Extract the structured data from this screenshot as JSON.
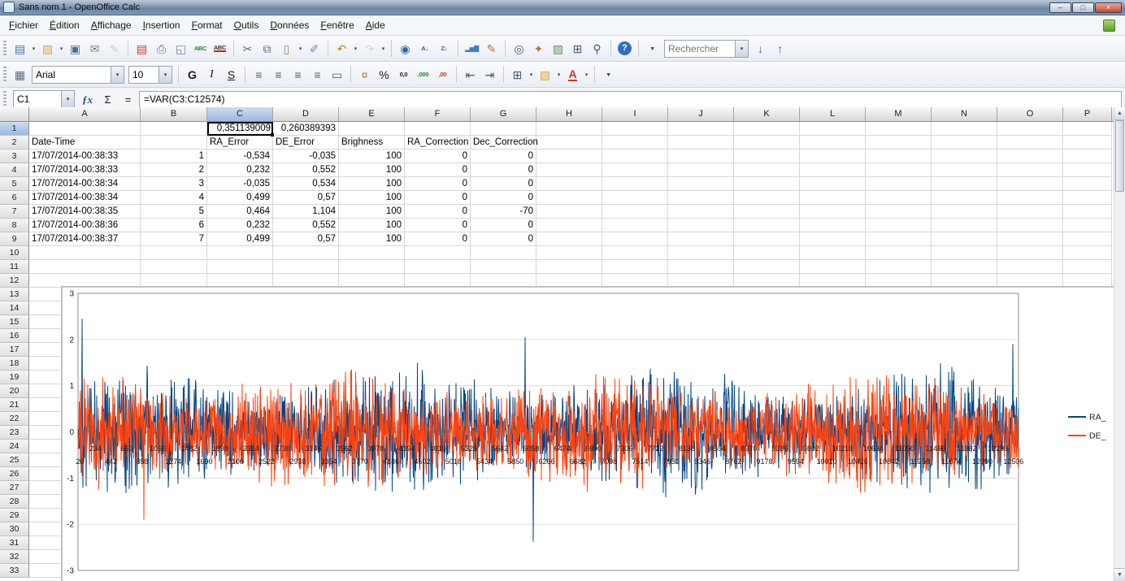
{
  "window": {
    "title": "Sans nom 1 - OpenOffice Calc",
    "controls": [
      {
        "name": "minimize",
        "glyph": "–"
      },
      {
        "name": "maximize",
        "glyph": "□"
      },
      {
        "name": "close",
        "glyph": "×"
      }
    ]
  },
  "menu_items": [
    "Fichier",
    "Édition",
    "Affichage",
    "Insertion",
    "Format",
    "Outils",
    "Données",
    "Fenêtre",
    "Aide"
  ],
  "ui": {
    "dropdown_glyph": "▾",
    "up_glyph": "▲",
    "down_glyph": "▼"
  },
  "search": {
    "placeholder": "Rechercher"
  },
  "standard_toolbar": {
    "items": [
      {
        "name": "new-document",
        "glyph": "▤",
        "color": "#4f6d99",
        "dropdown": true
      },
      {
        "name": "open-document",
        "glyph": "▨",
        "color": "#d9a33c",
        "dropdown": true
      },
      {
        "name": "save-document",
        "glyph": "▣",
        "color": "#4f6d99"
      },
      {
        "name": "document-as-email",
        "glyph": "✉",
        "color": "#6e7f94"
      },
      {
        "name": "edit-file",
        "glyph": "✎",
        "color": "#8a93a2",
        "disabled": true
      },
      {
        "sep": true
      },
      {
        "name": "export-pdf",
        "glyph": "▤",
        "color": "#c0392b"
      },
      {
        "name": "print-file",
        "glyph": "⎙",
        "color": "#5d6b7d"
      },
      {
        "name": "page-preview",
        "glyph": "◱",
        "color": "#7d8ba0"
      },
      {
        "name": "spellcheck",
        "glyph": "ABC",
        "color": "#2e7d32",
        "small": true
      },
      {
        "name": "auto-spellcheck",
        "glyph": "ABC",
        "color": "#333333",
        "small": true,
        "uline": "#cc2200"
      },
      {
        "sep": true
      },
      {
        "name": "cut",
        "glyph": "✂",
        "color": "#5d6b7d"
      },
      {
        "name": "copy",
        "glyph": "⧉",
        "color": "#5d6b7d"
      },
      {
        "name": "paste",
        "glyph": "▯",
        "color": "#a3825a",
        "dropdown": true
      },
      {
        "name": "clone-formatting",
        "glyph": "✐",
        "color": "#7d8ba0"
      },
      {
        "sep": true
      },
      {
        "name": "undo",
        "glyph": "↶",
        "color": "#b8860b",
        "dropdown": true
      },
      {
        "name": "redo",
        "glyph": "↷",
        "color": "#8fa3b8",
        "dropdown": true,
        "disabled": true
      },
      {
        "sep": true
      },
      {
        "name": "hyperlink",
        "glyph": "◉",
        "color": "#2e66a4"
      },
      {
        "name": "sort-ascending",
        "glyph": "A↓",
        "color": "#31608f",
        "small": true
      },
      {
        "name": "sort-descending",
        "glyph": "Z↓",
        "color": "#31608f",
        "small": true
      },
      {
        "sep": true
      },
      {
        "name": "insert-chart",
        "glyph": "▂▅▇",
        "color": "#3f7fc4",
        "small": true
      },
      {
        "name": "show-draw-functions",
        "glyph": "✎",
        "color": "#b5742f"
      },
      {
        "sep": true
      },
      {
        "name": "find-replace",
        "glyph": "◎",
        "color": "#4a5a6e"
      },
      {
        "name": "navigator",
        "glyph": "✦",
        "color": "#c2703a"
      },
      {
        "name": "gallery",
        "glyph": "▨",
        "color": "#5f8f5f"
      },
      {
        "name": "data-sources",
        "glyph": "⊞",
        "color": "#4a5a6e"
      },
      {
        "name": "zoom",
        "glyph": "⚲",
        "color": "#4a5a6e"
      },
      {
        "sep": true
      },
      {
        "name": "help",
        "glyph": "?",
        "color": "#ffffff",
        "bg": "#2f6fc1",
        "round": true
      },
      {
        "sep": true
      },
      {
        "name": "toolbar-overflow",
        "glyph": "▾",
        "color": "#3a4654",
        "small": true
      },
      {
        "type": "search"
      },
      {
        "name": "find-next",
        "glyph": "↓",
        "color": "#2e66a4"
      },
      {
        "name": "find-previous",
        "glyph": "↑",
        "color": "#2e66a4"
      }
    ]
  },
  "formatting_toolbar": {
    "font_name": "Arial",
    "font_size": "10",
    "items": [
      {
        "name": "styles-window",
        "glyph": "▦",
        "color": "#5d6b7d"
      },
      {
        "type": "fontname"
      },
      {
        "type": "fontsize"
      },
      {
        "sep": true
      },
      {
        "name": "bold",
        "glyph": "G",
        "color": "#1a1a1a",
        "style": "bold"
      },
      {
        "name": "italic",
        "glyph": "I",
        "color": "#1a1a1a",
        "style": "italic"
      },
      {
        "name": "underline",
        "glyph": "S",
        "color": "#1a1a1a",
        "style": "underline"
      },
      {
        "sep": true
      },
      {
        "name": "align-left",
        "glyph": "≡",
        "color": "#4a5a6e"
      },
      {
        "name": "align-center",
        "glyph": "≡",
        "color": "#4a5a6e"
      },
      {
        "name": "align-right",
        "glyph": "≡",
        "color": "#4a5a6e"
      },
      {
        "name": "align-justified",
        "glyph": "≡",
        "color": "#4a5a6e"
      },
      {
        "name": "merge-cells",
        "glyph": "▭",
        "color": "#4a5a6e"
      },
      {
        "sep": true
      },
      {
        "name": "number-format-currency",
        "glyph": "¤",
        "color": "#a08030"
      },
      {
        "name": "number-format-percent",
        "glyph": "%",
        "color": "#1a1a1a"
      },
      {
        "name": "number-format-standard",
        "glyph": "0,0",
        "color": "#1a1a1a",
        "small": true
      },
      {
        "name": "add-decimal-place",
        "glyph": ",000",
        "color": "#2e7d32",
        "small": true
      },
      {
        "name": "delete-decimal-place",
        "glyph": ",00",
        "color": "#c0392b",
        "small": true
      },
      {
        "sep": true
      },
      {
        "name": "decrease-indent",
        "glyph": "⇤",
        "color": "#4a5a6e"
      },
      {
        "name": "increase-indent",
        "glyph": "⇥",
        "color": "#4a5a6e"
      },
      {
        "sep": true
      },
      {
        "name": "borders",
        "glyph": "⊞",
        "color": "#4a5a6e",
        "dropdown": true
      },
      {
        "name": "background-color",
        "glyph": "▧",
        "color": "#d9a33c",
        "dropdown": true
      },
      {
        "name": "font-color",
        "glyph": "A",
        "color": "#c0392b",
        "style": "bold",
        "uline": "#c0392b",
        "dropdown": true
      },
      {
        "sep": true
      },
      {
        "name": "toolbar-overflow-formatting",
        "glyph": "▾",
        "color": "#3a4654",
        "small": true
      }
    ]
  },
  "formula_bar": {
    "cell_reference": "C1",
    "formula": "=VAR(C3:C12574)",
    "fx_glyph": "ƒx",
    "sum_glyph": "Σ",
    "equals_glyph": "="
  },
  "sheet": {
    "columns": [
      "A",
      "B",
      "C",
      "D",
      "E",
      "F",
      "G",
      "H",
      "I",
      "J",
      "K",
      "L",
      "M",
      "N",
      "O",
      "P"
    ],
    "row_count": 33,
    "selected_cell": "C1",
    "selected_column": "C",
    "selected_row": 1,
    "cells": {
      "1": {
        "C": "0,351139009",
        "D": "0,260389393"
      },
      "2": {
        "A": "Date-Time",
        "C": "RA_Error",
        "D": "DE_Error",
        "E": "Brighness",
        "F": "RA_Correction",
        "G": "Dec_Correction"
      },
      "3": {
        "A": "17/07/2014-00:38:33",
        "B": "1",
        "C": "-0,534",
        "D": "-0,035",
        "E": "100",
        "F": "0",
        "G": "0"
      },
      "4": {
        "A": "17/07/2014-00:38:33",
        "B": "2",
        "C": "0,232",
        "D": "0,552",
        "E": "100",
        "F": "0",
        "G": "0"
      },
      "5": {
        "A": "17/07/2014-00:38:34",
        "B": "3",
        "C": "-0,035",
        "D": "0,534",
        "E": "100",
        "F": "0",
        "G": "0"
      },
      "6": {
        "A": "17/07/2014-00:38:34",
        "B": "4",
        "C": "0,499",
        "D": "0,57",
        "E": "100",
        "F": "0",
        "G": "0"
      },
      "7": {
        "A": "17/07/2014-00:38:35",
        "B": "5",
        "C": "0,464",
        "D": "1,104",
        "E": "100",
        "F": "0",
        "G": "-70"
      },
      "8": {
        "A": "17/07/2014-00:38:36",
        "B": "6",
        "C": "0,232",
        "D": "0,552",
        "E": "100",
        "F": "0",
        "G": "0"
      },
      "9": {
        "A": "17/07/2014-00:38:37",
        "B": "7",
        "C": "0,499",
        "D": "0,57",
        "E": "100",
        "F": "0",
        "G": "0"
      }
    }
  },
  "chart_data": {
    "type": "line",
    "title": "",
    "x_max": 12574,
    "ylim": [
      -3,
      3
    ],
    "yticks": [
      "3",
      "2",
      "1",
      "0",
      "-1",
      "-2",
      "-3"
    ],
    "xticks": [
      26,
      234,
      442,
      650,
      858,
      1066,
      1274,
      1482,
      1690,
      1898,
      2106,
      2314,
      2522,
      2730,
      2938,
      3146,
      3354,
      3562,
      3770,
      3978,
      4186,
      4394,
      4602,
      4810,
      5018,
      5226,
      5434,
      5642,
      5850,
      6058,
      6266,
      6474,
      6682,
      6890,
      7098,
      7306,
      7514,
      7722,
      7930,
      8138,
      8346,
      8554,
      8762,
      8970,
      9178,
      9386,
      9594,
      9802,
      10010,
      10218,
      10426,
      10634,
      10842,
      11050,
      11258,
      11466,
      11674,
      11882,
      12090,
      12298,
      12506
    ],
    "series": [
      {
        "name": "RA_",
        "color": "#004586",
        "variance": "0,351139009",
        "approx_range": [
          -2.4,
          2.5
        ]
      },
      {
        "name": "DE_",
        "color": "#FF420E",
        "variance": "0,260389393",
        "approx_range": [
          -2.0,
          2.0
        ]
      }
    ],
    "legend_position": "right",
    "spikes": [
      {
        "series": 0,
        "x": 54,
        "value": 2.45
      },
      {
        "series": 0,
        "x": 5980,
        "value": 2.05
      },
      {
        "series": 0,
        "x": 6085,
        "value": -2.38
      },
      {
        "series": 0,
        "x": 12500,
        "value": 1.9
      },
      {
        "series": 1,
        "x": 880,
        "value": -1.9
      }
    ]
  }
}
